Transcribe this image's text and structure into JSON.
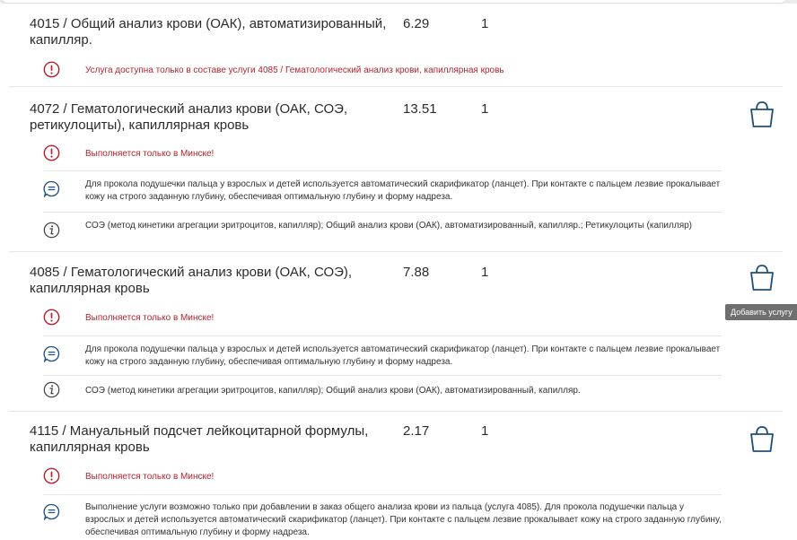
{
  "colors": {
    "warning": "#b3232e",
    "icon_blue": "#1e4f7a",
    "icon_gray": "#444444",
    "divider": "#e6e6e6"
  },
  "services": [
    {
      "title": "4015 / Общий анализ крови (ОАК), автоматизированный, капилляр.",
      "price": "6.29",
      "qty": "1",
      "has_cart": false,
      "notes": [
        {
          "icon": "exclamation-circle-icon",
          "kind": "warning",
          "text": "Услуга доступна только в составе услуги 4085 / Гематологический анализ крови, капиллярная кровь"
        }
      ]
    },
    {
      "title": "4072 / Гематологический анализ крови (ОАК, СОЭ, ретикулоциты), капиллярная кровь",
      "price": "13.51",
      "qty": "1",
      "has_cart": true,
      "notes": [
        {
          "icon": "exclamation-circle-icon",
          "kind": "warning",
          "text": "Выполняется только в Минске!"
        },
        {
          "icon": "comment-icon",
          "kind": "info",
          "text": "Для прокола подушечки пальца у взрослых и детей используется автоматический скарификатор (ланцет). При контакте с пальцем лезвие прокалывает кожу на строго заданную глубину, обеспечивая оптимальную глубину и форму надреза."
        },
        {
          "icon": "info-icon",
          "kind": "info",
          "text": "СОЭ (метод кинетики агрегации эритроцитов, капилляр); Общий анализ крови (ОАК), автоматизированный, капилляр.; Ретикулоциты (капилляр)"
        }
      ]
    },
    {
      "title": "4085 / Гематологический анализ крови (ОАК, СОЭ), капиллярная кровь",
      "price": "7.88",
      "qty": "1",
      "has_cart": true,
      "notes": [
        {
          "icon": "exclamation-circle-icon",
          "kind": "warning",
          "text": "Выполняется только в Минске!"
        },
        {
          "icon": "comment-icon",
          "kind": "info",
          "text": "Для прокола подушечки пальца у взрослых и детей используется автоматический скарификатор (ланцет). При контакте с пальцем лезвие прокалывает кожу на строго заданную глубину, обеспечивая оптимальную глубину и форму надреза."
        },
        {
          "icon": "info-icon",
          "kind": "info",
          "text": "СОЭ (метод кинетики агрегации эритроцитов, капилляр); Общий анализ крови (ОАК), автоматизированный, капилляр."
        }
      ]
    },
    {
      "title": "4115 / Мануальный подсчет лейкоцитарной формулы, капиллярная кровь",
      "price": "2.17",
      "qty": "1",
      "has_cart": true,
      "notes": [
        {
          "icon": "exclamation-circle-icon",
          "kind": "warning",
          "text": "Выполняется только в Минске!"
        },
        {
          "icon": "comment-icon",
          "kind": "info",
          "text": "Выполнение услуги возможно только при добавлении в заказ общего анализа крови из пальца (услуга 4085). Для прокола подушечки пальца у взрослых и детей используется автоматический скарификатор (ланцет). При контакте с пальцем лезвие прокалывает кожу на строго заданную глубину, обеспечивая оптимальную глубину и форму надреза."
        }
      ]
    }
  ],
  "tooltip": {
    "text": "Добавить услугу"
  }
}
